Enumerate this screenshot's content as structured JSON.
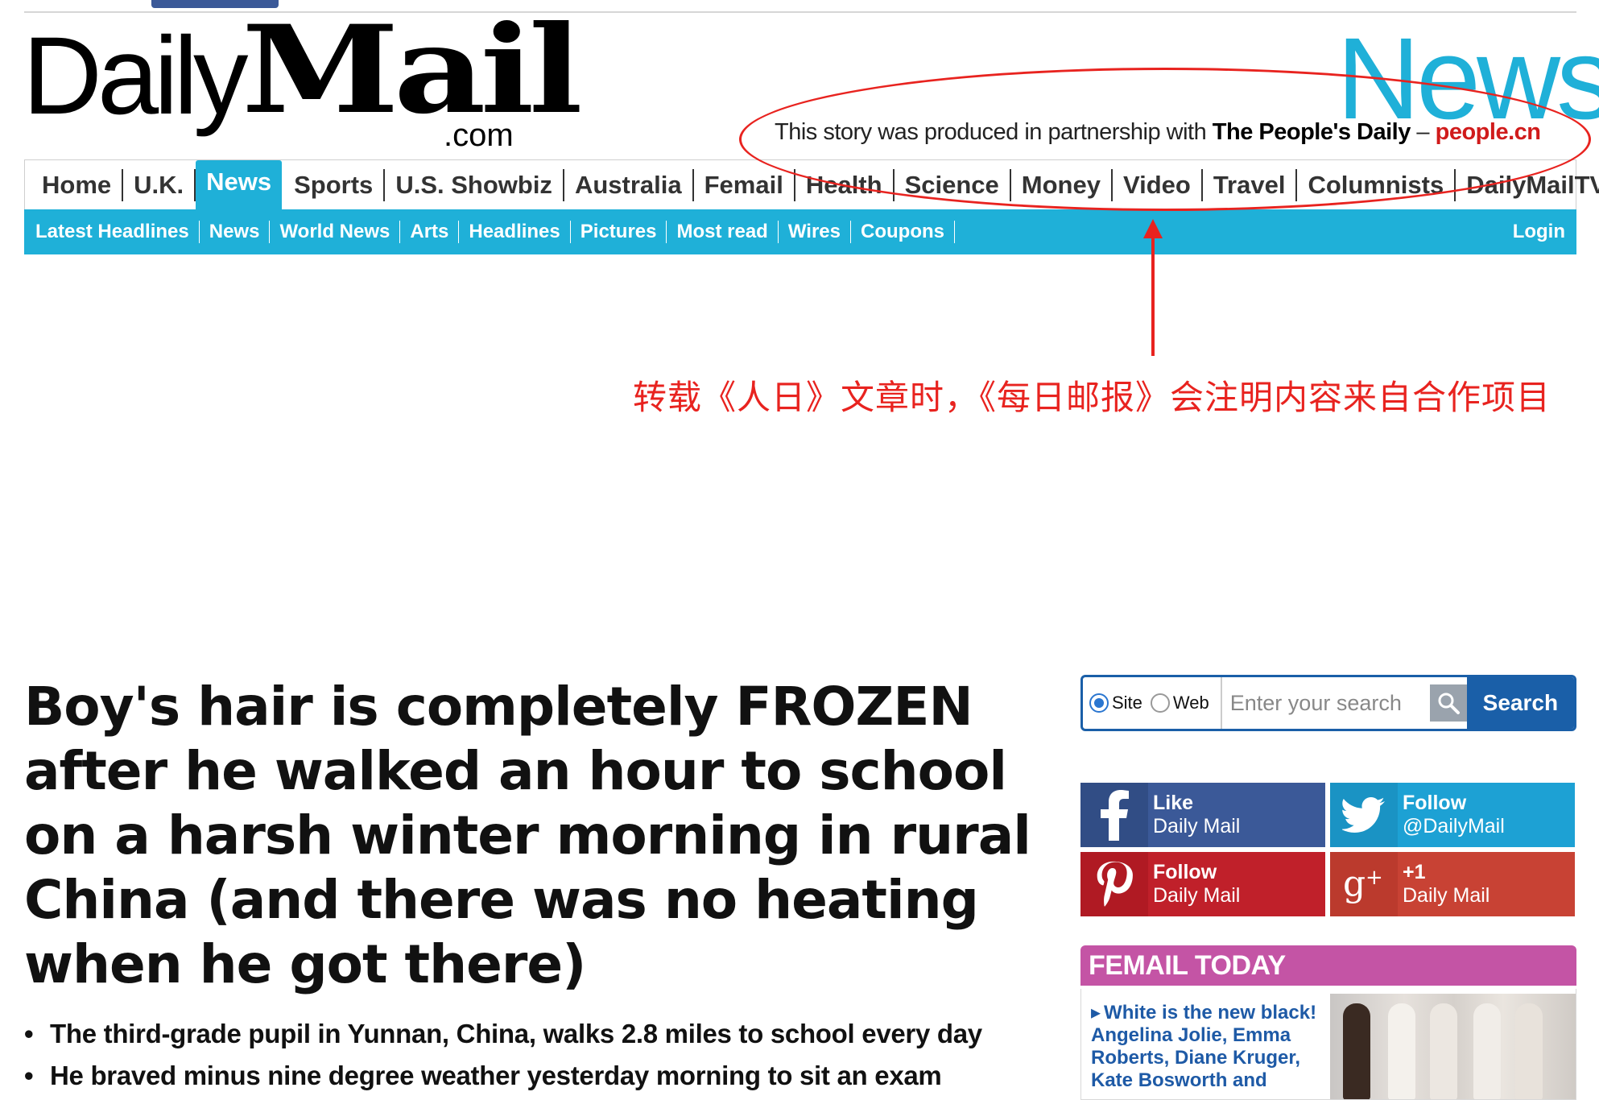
{
  "masthead": {
    "logo_daily": "Daily",
    "logo_mail": "Mail",
    "logo_com": ".com",
    "section_word": "News",
    "partner_prefix": "This story was produced in partnership with ",
    "partner_name": "The People's Daily",
    "partner_dash": " – ",
    "partner_site": "people.cn"
  },
  "primary_nav": [
    {
      "label": "Home"
    },
    {
      "label": "U.K."
    },
    {
      "label": "News",
      "active": true
    },
    {
      "label": "Sports"
    },
    {
      "label": "U.S. Showbiz"
    },
    {
      "label": "Australia"
    },
    {
      "label": "Femail"
    },
    {
      "label": "Health"
    },
    {
      "label": "Science"
    },
    {
      "label": "Money"
    },
    {
      "label": "Video"
    },
    {
      "label": "Travel"
    },
    {
      "label": "Columnists"
    },
    {
      "label": "DailyMailTV"
    }
  ],
  "secondary_nav": [
    {
      "label": "Latest Headlines"
    },
    {
      "label": "News"
    },
    {
      "label": "World News"
    },
    {
      "label": "Arts"
    },
    {
      "label": "Headlines"
    },
    {
      "label": "Pictures"
    },
    {
      "label": "Most read"
    },
    {
      "label": "Wires"
    },
    {
      "label": "Coupons"
    }
  ],
  "login_label": "Login",
  "annotation": {
    "caption": "转载《人日》文章时，《每日邮报》会注明内容来自合作项目",
    "color": "#e8231f"
  },
  "article": {
    "headline": "Boy's hair is completely FROZEN after he walked an hour to school on a harsh winter morning in rural China (and there was no heating when he got there)",
    "bullets": [
      "The third-grade pupil in Yunnan, China, walks 2.8 miles to school every day",
      "He braved minus nine degree weather yesterday morning to sit an exam"
    ]
  },
  "search": {
    "radio_site": "Site",
    "radio_web": "Web",
    "selected": "Site",
    "placeholder": "Enter your search",
    "button_label": "Search"
  },
  "social": {
    "facebook": {
      "line1": "Like",
      "line2": "Daily Mail",
      "icon": "facebook-icon",
      "color": "#3b5998"
    },
    "twitter": {
      "line1": "Follow",
      "line2": "@DailyMail",
      "icon": "twitter-icon",
      "color": "#1da1d4"
    },
    "pinterest": {
      "line1": "Follow",
      "line2": "Daily Mail",
      "icon": "pinterest-icon",
      "color": "#c0202a"
    },
    "googleplus": {
      "line1": "+1",
      "line2": "Daily Mail",
      "icon": "google-plus-icon",
      "color": "#c84234"
    }
  },
  "femail": {
    "header": "FEMAIL TODAY",
    "teaser_lead": "White is the new black!",
    "teaser_rest": "Angelina Jolie, Emma Roberts, Diane Kruger, Kate Bosworth and"
  },
  "colors": {
    "brand_blue": "#1fb0d8",
    "search_blue": "#1a5fa8",
    "femail_pink": "#c454a5",
    "link_blue": "#1e5aa6"
  }
}
